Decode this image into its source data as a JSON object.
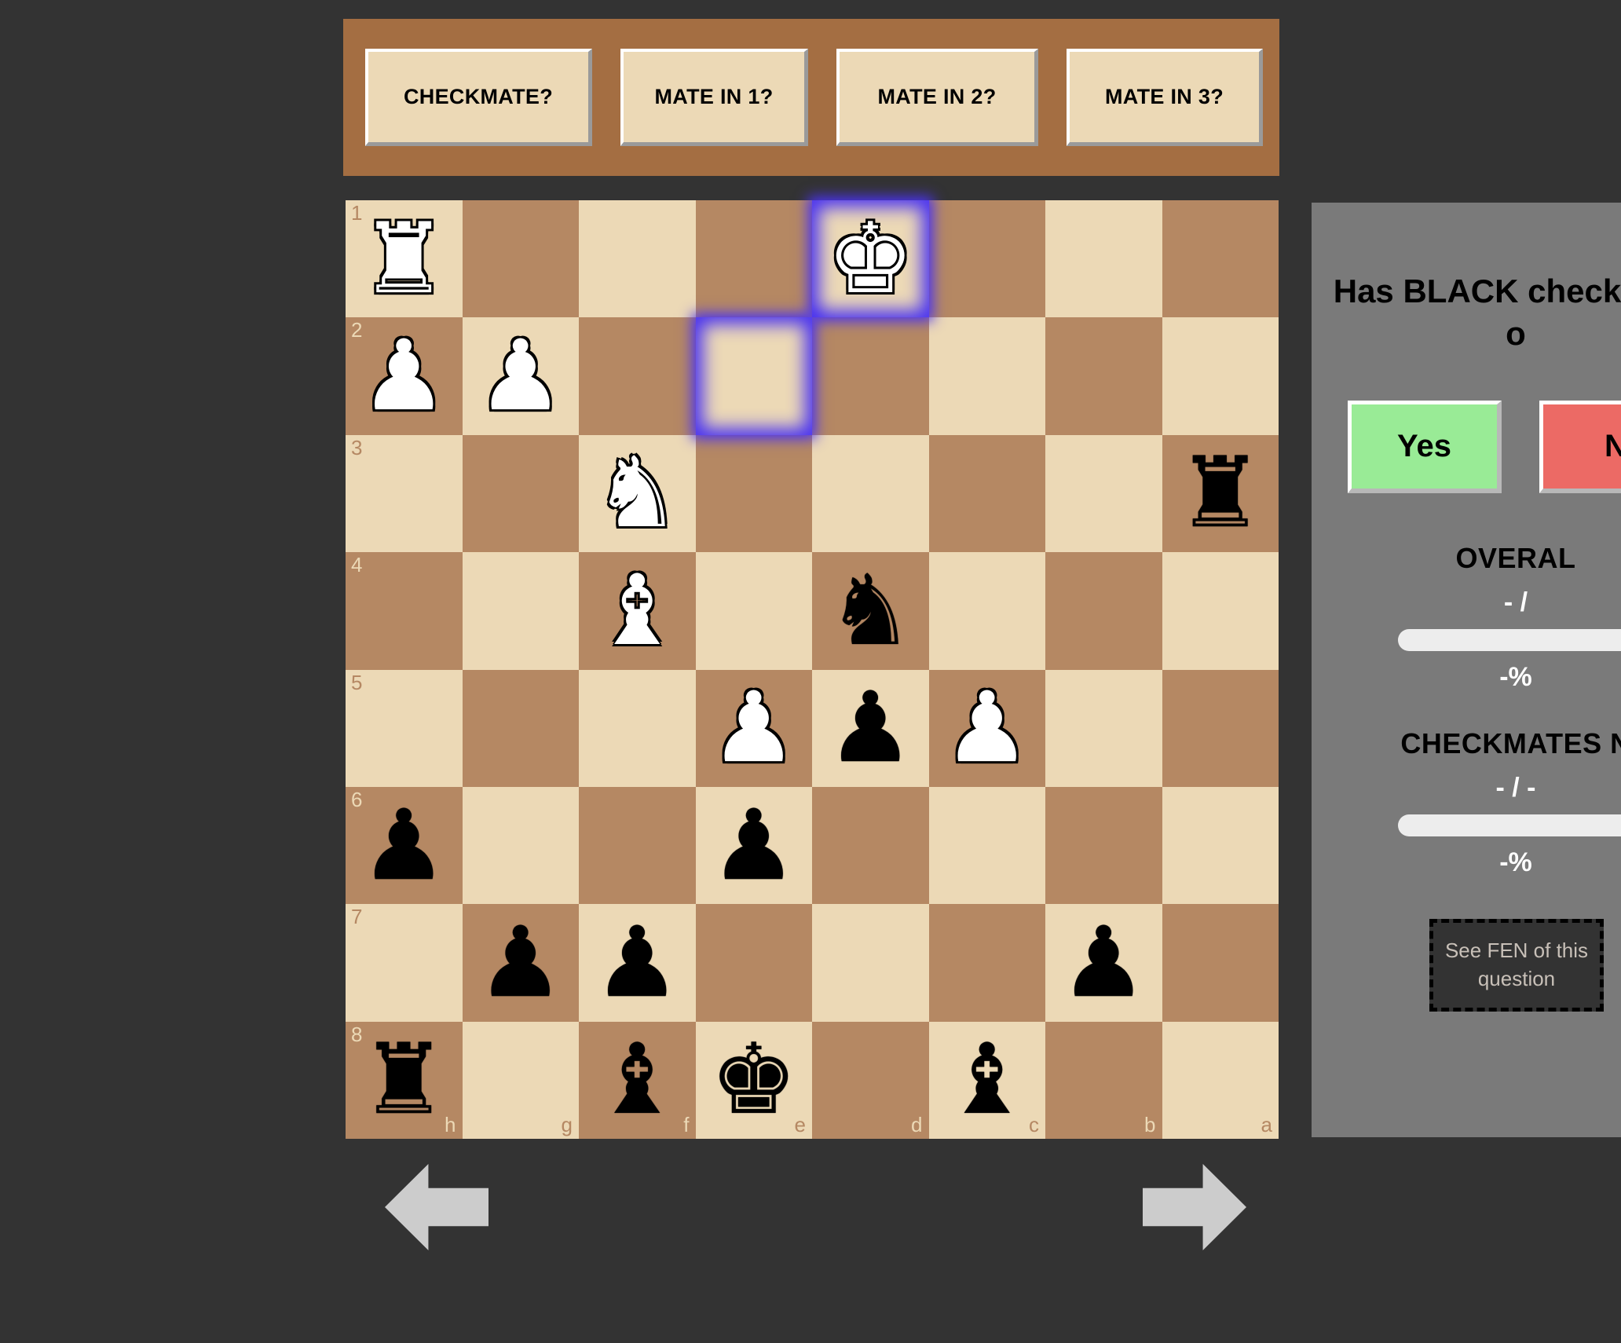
{
  "topbar": {
    "buttons": [
      {
        "label": "CHECKMATE?"
      },
      {
        "label": "MATE IN 1?"
      },
      {
        "label": "MATE IN 2?"
      },
      {
        "label": "MATE IN 3?"
      }
    ]
  },
  "board": {
    "orientation": "black",
    "rank_labels": [
      "1",
      "2",
      "3",
      "4",
      "5",
      "6",
      "7",
      "8"
    ],
    "file_labels": [
      "h",
      "g",
      "f",
      "e",
      "d",
      "c",
      "b",
      "a"
    ],
    "light_color": "#ecd9b6",
    "dark_color": "#b58863",
    "highlight_color": "#4a33f0",
    "rows": [
      {
        "rank": "1",
        "cells": [
          {
            "piece": "white-rook",
            "glyph": "♜",
            "color": "w"
          },
          {
            "piece": null
          },
          {
            "piece": null
          },
          {
            "piece": null
          },
          {
            "piece": "white-king",
            "glyph": "♚",
            "color": "w",
            "highlight": true
          },
          {
            "piece": null
          },
          {
            "piece": null
          },
          {
            "piece": null
          }
        ]
      },
      {
        "rank": "2",
        "cells": [
          {
            "piece": "white-pawn",
            "glyph": "♟",
            "color": "w"
          },
          {
            "piece": "white-pawn",
            "glyph": "♟",
            "color": "w"
          },
          {
            "piece": null
          },
          {
            "piece": null,
            "highlight": true
          },
          {
            "piece": null
          },
          {
            "piece": null
          },
          {
            "piece": null
          },
          {
            "piece": null
          }
        ]
      },
      {
        "rank": "3",
        "cells": [
          {
            "piece": null
          },
          {
            "piece": null
          },
          {
            "piece": "white-knight",
            "glyph": "♞",
            "color": "w"
          },
          {
            "piece": null
          },
          {
            "piece": null
          },
          {
            "piece": null
          },
          {
            "piece": null
          },
          {
            "piece": "black-rook",
            "glyph": "♜",
            "color": "b"
          }
        ]
      },
      {
        "rank": "4",
        "cells": [
          {
            "piece": null
          },
          {
            "piece": null
          },
          {
            "piece": "white-bishop",
            "glyph": "♝",
            "color": "w"
          },
          {
            "piece": null
          },
          {
            "piece": "black-knight",
            "glyph": "♞",
            "color": "b"
          },
          {
            "piece": null
          },
          {
            "piece": null
          },
          {
            "piece": null
          }
        ]
      },
      {
        "rank": "5",
        "cells": [
          {
            "piece": null
          },
          {
            "piece": null
          },
          {
            "piece": null
          },
          {
            "piece": "white-pawn",
            "glyph": "♟",
            "color": "w"
          },
          {
            "piece": "black-pawn",
            "glyph": "♟",
            "color": "b"
          },
          {
            "piece": "white-pawn",
            "glyph": "♟",
            "color": "w"
          },
          {
            "piece": null
          },
          {
            "piece": null
          }
        ]
      },
      {
        "rank": "6",
        "cells": [
          {
            "piece": "black-pawn",
            "glyph": "♟",
            "color": "b"
          },
          {
            "piece": null
          },
          {
            "piece": null
          },
          {
            "piece": "black-pawn",
            "glyph": "♟",
            "color": "b"
          },
          {
            "piece": null
          },
          {
            "piece": null
          },
          {
            "piece": null
          },
          {
            "piece": null
          }
        ]
      },
      {
        "rank": "7",
        "cells": [
          {
            "piece": null
          },
          {
            "piece": "black-pawn",
            "glyph": "♟",
            "color": "b"
          },
          {
            "piece": "black-pawn",
            "glyph": "♟",
            "color": "b"
          },
          {
            "piece": null
          },
          {
            "piece": null
          },
          {
            "piece": null
          },
          {
            "piece": "black-pawn",
            "glyph": "♟",
            "color": "b"
          },
          {
            "piece": null
          }
        ]
      },
      {
        "rank": "8",
        "cells": [
          {
            "piece": "black-rook",
            "glyph": "♜",
            "color": "b"
          },
          {
            "piece": null
          },
          {
            "piece": "black-bishop",
            "glyph": "♝",
            "color": "b"
          },
          {
            "piece": "black-king",
            "glyph": "♚",
            "color": "b"
          },
          {
            "piece": null
          },
          {
            "piece": "black-bishop",
            "glyph": "♝",
            "color": "b"
          },
          {
            "piece": null
          },
          {
            "piece": null
          }
        ]
      }
    ]
  },
  "nav": {
    "prev_icon": "arrow-left-icon",
    "next_icon": "arrow-right-icon"
  },
  "panel": {
    "question": "Has BLACK checkmate o",
    "yes_label": "Yes",
    "no_label": "N",
    "yes_color": "#99eb96",
    "no_color": "#ec6a65",
    "stats": [
      {
        "title": "OVERAL",
        "value": "- /",
        "percent": "-%"
      },
      {
        "title": "CHECKMATES   N",
        "value": "- / -",
        "percent": "-%"
      }
    ],
    "fen_button": "See FEN of this question"
  }
}
